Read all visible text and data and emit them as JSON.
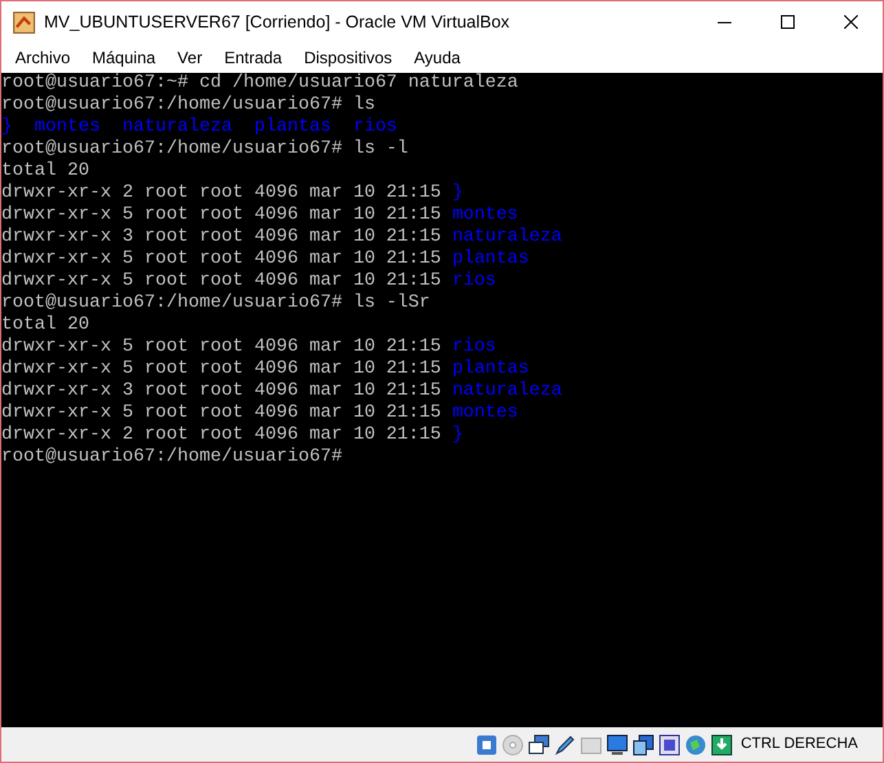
{
  "window": {
    "title": "MV_UBUNTUSERVER67 [Corriendo] - Oracle VM VirtualBox"
  },
  "menu": [
    "Archivo",
    "Máquina",
    "Ver",
    "Entrada",
    "Dispositivos",
    "Ayuda"
  ],
  "terminal": {
    "lines": [
      [
        {
          "text": "root@usuario67:~# cd /home/usuario67 naturaleza",
          "kind": "plain"
        }
      ],
      [
        {
          "text": "root@usuario67:/home/usuario67# ls",
          "kind": "plain"
        }
      ],
      [
        {
          "text": "}  montes  naturaleza  plantas  rios",
          "kind": "directory"
        }
      ],
      [
        {
          "text": "root@usuario67:/home/usuario67# ls -l",
          "kind": "plain"
        }
      ],
      [
        {
          "text": "total 20",
          "kind": "plain"
        }
      ],
      [
        {
          "text": "drwxr-xr-x 2 root root 4096 mar 10 21:15 ",
          "kind": "plain"
        },
        {
          "text": "}",
          "kind": "directory"
        }
      ],
      [
        {
          "text": "drwxr-xr-x 5 root root 4096 mar 10 21:15 ",
          "kind": "plain"
        },
        {
          "text": "montes",
          "kind": "directory"
        }
      ],
      [
        {
          "text": "drwxr-xr-x 3 root root 4096 mar 10 21:15 ",
          "kind": "plain"
        },
        {
          "text": "naturaleza",
          "kind": "directory"
        }
      ],
      [
        {
          "text": "drwxr-xr-x 5 root root 4096 mar 10 21:15 ",
          "kind": "plain"
        },
        {
          "text": "plantas",
          "kind": "directory"
        }
      ],
      [
        {
          "text": "drwxr-xr-x 5 root root 4096 mar 10 21:15 ",
          "kind": "plain"
        },
        {
          "text": "rios",
          "kind": "directory"
        }
      ],
      [
        {
          "text": "root@usuario67:/home/usuario67# ls -lSr",
          "kind": "plain"
        }
      ],
      [
        {
          "text": "total 20",
          "kind": "plain"
        }
      ],
      [
        {
          "text": "drwxr-xr-x 5 root root 4096 mar 10 21:15 ",
          "kind": "plain"
        },
        {
          "text": "rios",
          "kind": "directory"
        }
      ],
      [
        {
          "text": "drwxr-xr-x 5 root root 4096 mar 10 21:15 ",
          "kind": "plain"
        },
        {
          "text": "plantas",
          "kind": "directory"
        }
      ],
      [
        {
          "text": "drwxr-xr-x 3 root root 4096 mar 10 21:15 ",
          "kind": "plain"
        },
        {
          "text": "naturaleza",
          "kind": "directory"
        }
      ],
      [
        {
          "text": "drwxr-xr-x 5 root root 4096 mar 10 21:15 ",
          "kind": "plain"
        },
        {
          "text": "montes",
          "kind": "directory"
        }
      ],
      [
        {
          "text": "drwxr-xr-x 2 root root 4096 mar 10 21:15 ",
          "kind": "plain"
        },
        {
          "text": "}",
          "kind": "directory"
        }
      ],
      [
        {
          "text": "root@usuario67:/home/usuario67#",
          "kind": "plain"
        }
      ]
    ]
  },
  "status_bar": {
    "host_key": "CTRL DERECHA"
  }
}
